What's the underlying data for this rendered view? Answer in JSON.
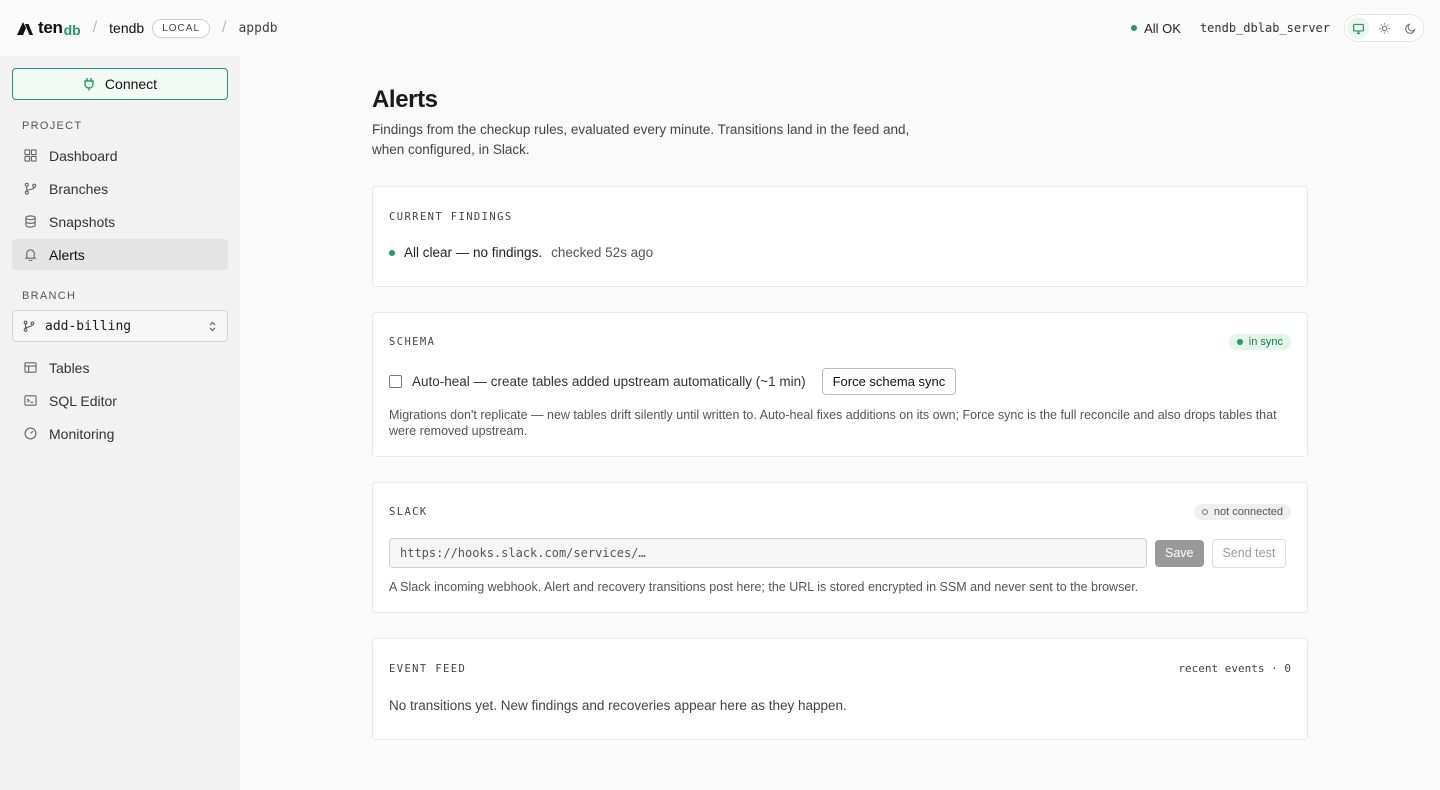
{
  "header": {
    "logo_ten": "ten",
    "logo_db": "db",
    "project": "tendb",
    "env_badge": "LOCAL",
    "database": "appdb",
    "status": "All OK",
    "server": "tendb_dblab_server",
    "theme_modes": [
      "system",
      "light",
      "dark"
    ]
  },
  "sidebar": {
    "connect_label": "Connect",
    "project_section": "PROJECT",
    "project_items": [
      {
        "label": "Dashboard",
        "icon": "grid-icon"
      },
      {
        "label": "Branches",
        "icon": "git-branch-icon"
      },
      {
        "label": "Snapshots",
        "icon": "database-icon"
      },
      {
        "label": "Alerts",
        "icon": "bell-icon",
        "active": true
      }
    ],
    "branch_section": "BRANCH",
    "branch_value": "add-billing",
    "branch_items": [
      {
        "label": "Tables",
        "icon": "table-icon"
      },
      {
        "label": "SQL Editor",
        "icon": "terminal-icon"
      },
      {
        "label": "Monitoring",
        "icon": "gauge-icon"
      }
    ]
  },
  "main": {
    "title": "Alerts",
    "description": "Findings from the checkup rules, evaluated every minute. Transitions land in the feed and, when configured, in Slack.",
    "findings": {
      "title": "CURRENT FINDINGS",
      "status": "All clear — no findings.",
      "checked": "checked 52s ago"
    },
    "schema": {
      "title": "SCHEMA",
      "badge": "in sync",
      "autoheal_label": "Auto-heal — create tables added upstream automatically (~1 min)",
      "autoheal_checked": false,
      "force_label": "Force schema sync",
      "note": "Migrations don't replicate — new tables drift silently until written to. Auto-heal fixes additions on its own; Force sync is the full reconcile and also drops tables that were removed upstream."
    },
    "slack": {
      "title": "SLACK",
      "badge": "not connected",
      "placeholder": "https://hooks.slack.com/services/…",
      "save_label": "Save",
      "test_label": "Send test",
      "note": "A Slack incoming webhook. Alert and recovery transitions post here; the URL is stored encrypted in SSM and never sent to the browser."
    },
    "feed": {
      "title": "EVENT FEED",
      "count": "recent events · 0",
      "empty": "No transitions yet. New findings and recoveries appear here as they happen."
    }
  },
  "colors": {
    "accent": "#1f9d62",
    "sidebar_bg": "#f2f2f2",
    "page_bg": "#fafafa"
  }
}
